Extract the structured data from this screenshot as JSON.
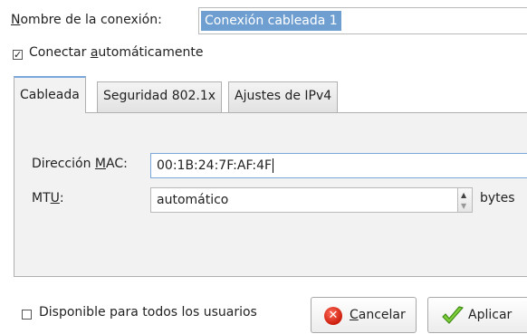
{
  "connection": {
    "name_label": "Nombre de la conexión:",
    "name_value": "Conexión cableada 1"
  },
  "auto_connect": {
    "label_pre": "Conectar ",
    "label_mnemonic": "a",
    "label_post": "utomáticamente",
    "checked": true
  },
  "tabs": [
    {
      "label": "Cableada",
      "active": true
    },
    {
      "label": "Seguridad 802.1x",
      "active": false
    },
    {
      "label": "Ajustes de IPv4",
      "active": false
    }
  ],
  "wired": {
    "mac_label_pre": "Dirección ",
    "mac_label_mnemonic": "M",
    "mac_label_post": "AC:",
    "mac_value": "00:1B:24:7F:AF:4F",
    "mtu_label_pre": "MT",
    "mtu_label_mnemonic": "U",
    "mtu_label_post": ":",
    "mtu_value": "automático",
    "mtu_units": "bytes"
  },
  "all_users": {
    "label": "Disponible para todos los usuarios",
    "checked": false
  },
  "buttons": {
    "cancel_mnemonic": "C",
    "cancel_rest": "ancelar",
    "apply_label": "Aplicar"
  },
  "colors": {
    "selection": "#6f9fd1",
    "active_tab_accent": "#7aa7dc",
    "cancel_icon": "#cc1d0c",
    "apply_icon": "#6fbf2a"
  }
}
